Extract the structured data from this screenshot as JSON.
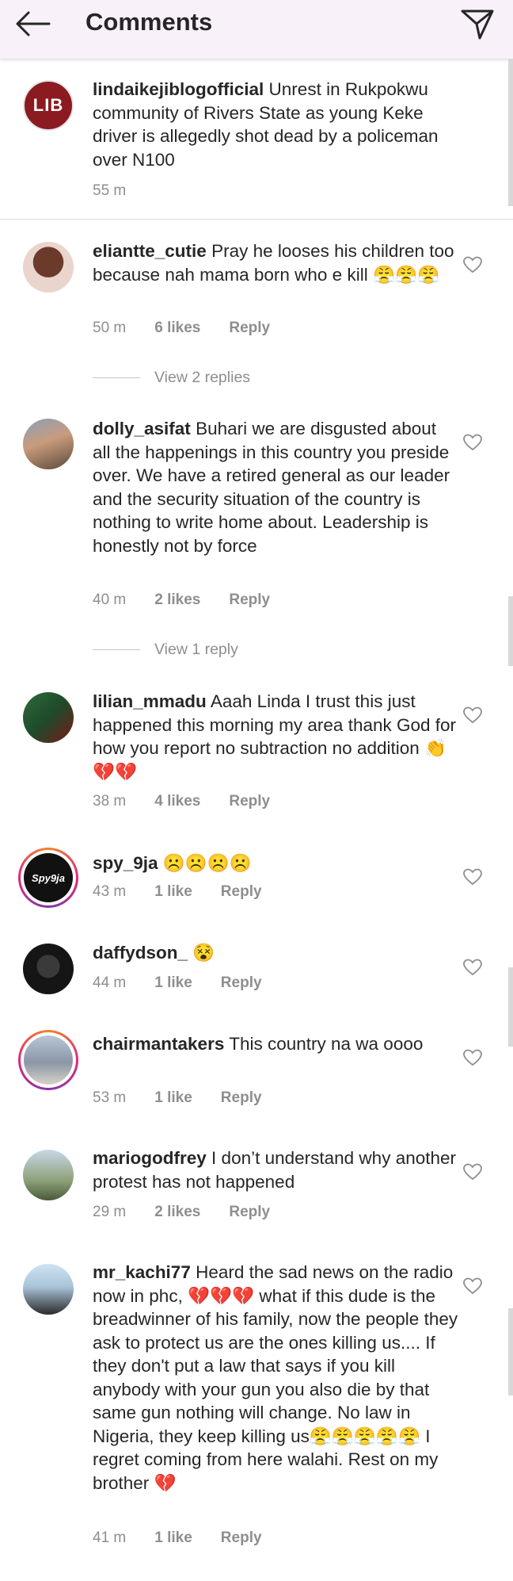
{
  "header": {
    "title": "Comments"
  },
  "caption": {
    "logo_text": "LIB",
    "username": "lindaikejiblogofficial",
    "text": "Unrest in Rukpokwu community of Rivers State as young Keke driver is allegedly shot dead by a policeman over N100",
    "time": "55 m"
  },
  "comments": [
    {
      "username": "eliantte_cutie",
      "text": "Pray he looses his children too because nah mama born who e kill 😤😤😤",
      "time": "50 m",
      "likes": "6 likes",
      "reply": "Reply",
      "view_replies": "View 2 replies"
    },
    {
      "username": "dolly_asifat",
      "text": "Buhari we are disgusted about all the happenings in this country you preside over. We have a retired general as our leader and the security situation of the country is nothing to write home about. Leadership is honestly not by force",
      "time": "40 m",
      "likes": "2 likes",
      "reply": "Reply",
      "view_replies": "View 1 reply"
    },
    {
      "username": "lilian_mmadu",
      "text": "Aaah Linda I trust this just happened this morning my area thank God for how you report no subtraction no addition 👏💔💔",
      "time": "38 m",
      "likes": "4 likes",
      "reply": "Reply"
    },
    {
      "username": "spy_9ja",
      "text": "☹️☹️☹️☹️",
      "time": "43 m",
      "likes": "1 like",
      "reply": "Reply",
      "avatar_text": "Spy9ja"
    },
    {
      "username": "daffydson_",
      "text": "😵",
      "time": "44 m",
      "likes": "1 like",
      "reply": "Reply"
    },
    {
      "username": "chairmantakers",
      "text": "This country na wa oooo",
      "time": "53 m",
      "likes": "1 like",
      "reply": "Reply"
    },
    {
      "username": "mariogodfrey",
      "text": "I don’t understand why another protest has not happened",
      "time": "29 m",
      "likes": "2 likes",
      "reply": "Reply"
    },
    {
      "username": "mr_kachi77",
      "text": "Heard the sad news on the radio now in phc, 💔💔💔 what if this dude is the breadwinner of his family, now the people they ask to protect us are the ones killing us.... If they don't put a law that says if you kill anybody with your gun you also die by that same gun nothing will change. No law in Nigeria, they keep killing us😤😤😤😤😤 I regret coming from here walahi. Rest on my brother 💔",
      "time": "41 m",
      "likes": "1 like",
      "reply": "Reply"
    }
  ],
  "colors": {
    "header_bg": "#f9f1f9",
    "text": "#262626",
    "meta": "#8e8e8e",
    "lib_red": "#8b1b21"
  }
}
